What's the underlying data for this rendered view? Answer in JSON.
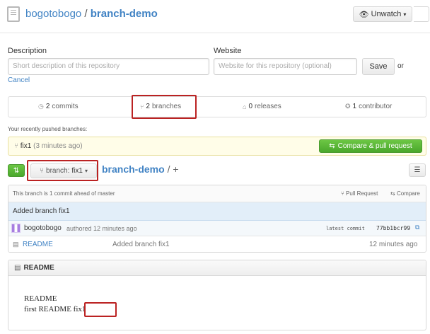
{
  "header": {
    "owner": "bogotobogo",
    "separator": "/",
    "repo": "branch-demo",
    "watch_button": "Unwatch",
    "watch_caret": "▾"
  },
  "description": {
    "label": "Description",
    "placeholder": "Short description of this repository"
  },
  "website": {
    "label": "Website",
    "placeholder": "Website for this repository (optional)",
    "save_label": "Save",
    "or_text": "or"
  },
  "cancel_label": "Cancel",
  "stats": {
    "commits": {
      "count": "2",
      "label": "commits"
    },
    "branches": {
      "count": "2",
      "label": "branches"
    },
    "releases": {
      "count": "0",
      "label": "releases"
    },
    "contributors": {
      "count": "1",
      "label": "contributor"
    }
  },
  "recent": {
    "heading": "Your recently pushed branches:",
    "branch": "fix1",
    "time": "(3 minutes ago)",
    "compare_label": "Compare & pull request"
  },
  "branch_bar": {
    "branch_prefix": "branch:",
    "branch_name": "fix1",
    "caret": "▾",
    "repo_link": "branch-demo",
    "path_rest": "/ +"
  },
  "file_table": {
    "ahead_text": "This branch is 1 commit ahead of master",
    "pull_request_label": "Pull Request",
    "compare_label": "Compare",
    "commit_message": "Added branch fix1",
    "author": "bogotobogo",
    "authored_text": "authored 12 minutes ago",
    "latest_commit_label": "latest commit",
    "commit_sha": "77bb1bcr99",
    "files": [
      {
        "name": "README",
        "message": "Added branch fix1",
        "age": "12 minutes ago"
      }
    ]
  },
  "readme": {
    "title": "README",
    "line1": "README",
    "line2_prefix": "first README ",
    "line2_highlight": "fix1"
  },
  "colors": {
    "link": "#4183c4",
    "accent_green": "#6cc644",
    "highlight_box": "#b22222"
  }
}
